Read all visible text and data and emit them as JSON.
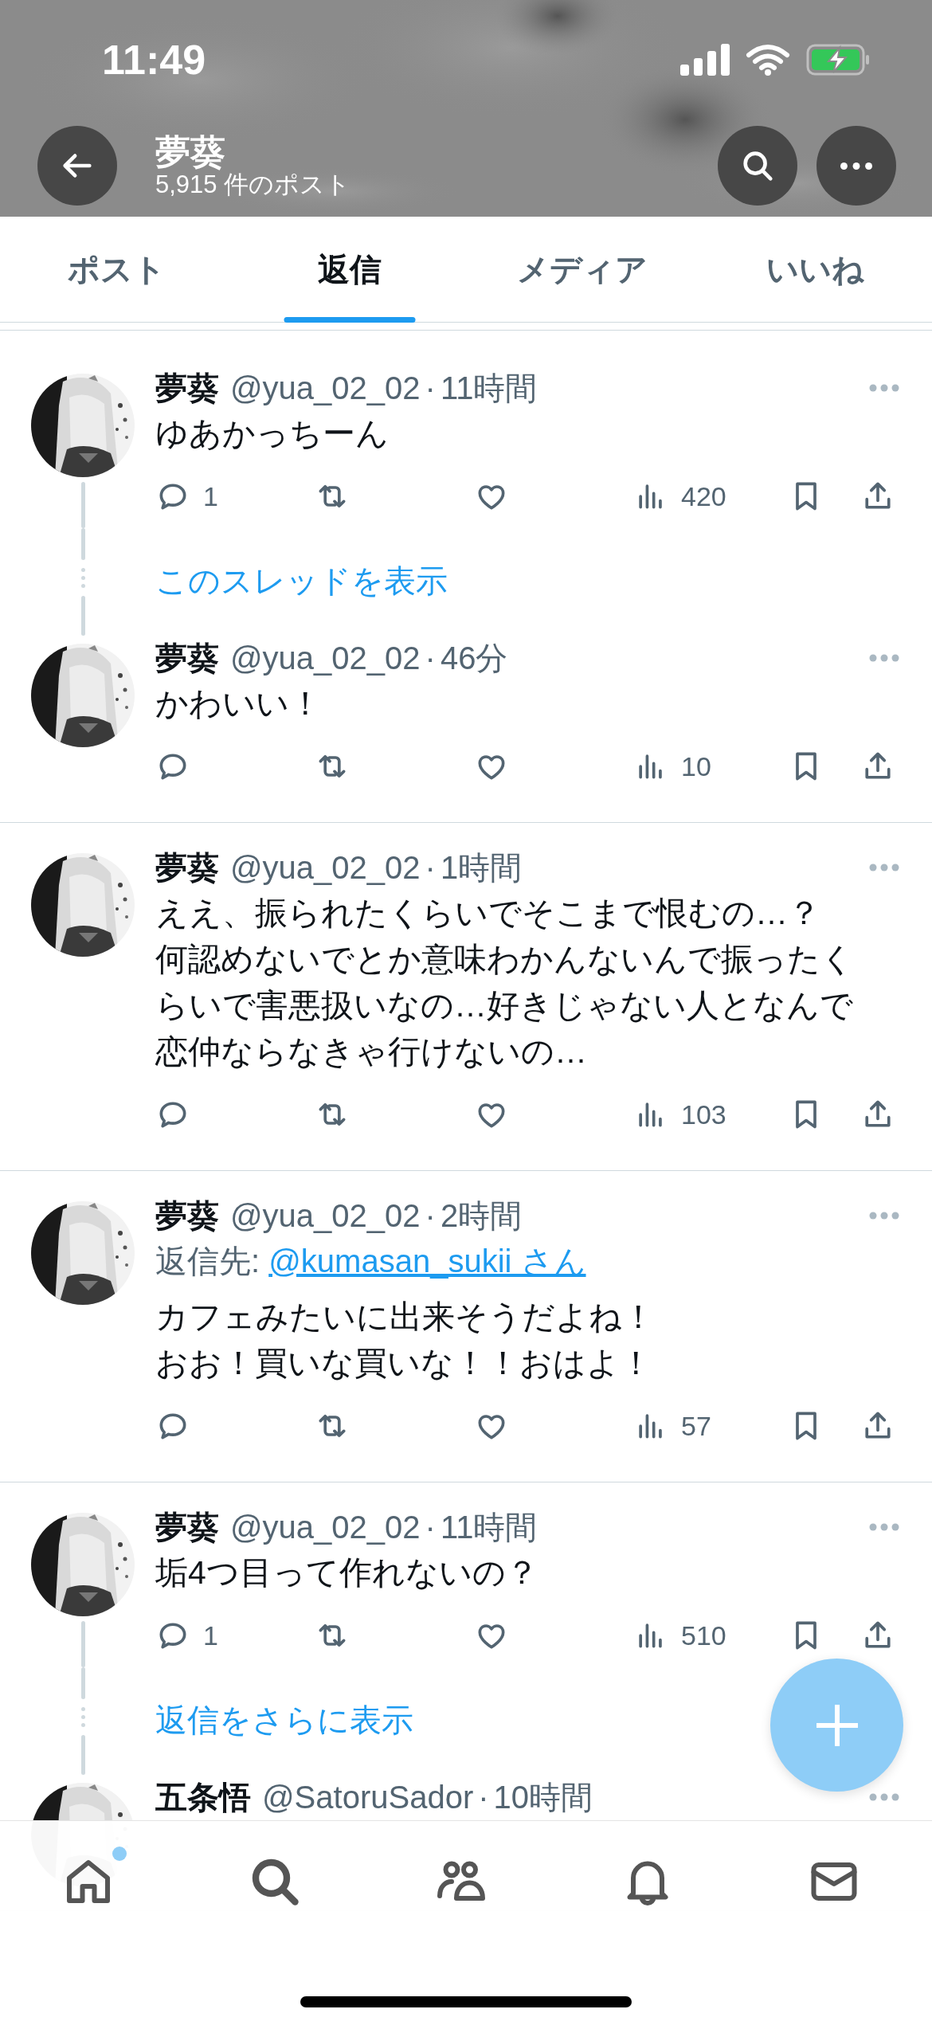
{
  "status_bar": {
    "time": "11:49"
  },
  "header": {
    "title": "夢葵",
    "subtitle": "5,915 件のポスト"
  },
  "tabs": [
    {
      "label": "ポスト",
      "selected": false
    },
    {
      "label": "返信",
      "selected": true
    },
    {
      "label": "メディア",
      "selected": false
    },
    {
      "label": "いいね",
      "selected": false
    }
  ],
  "threads": [
    {
      "items": [
        {
          "kind": "post",
          "name": "夢葵",
          "handle": "@yua_02_02",
          "separator": "·",
          "time": "11時間",
          "text": "ゆあかっちーん",
          "actions": {
            "replies": "1",
            "views": "420"
          }
        },
        {
          "kind": "link",
          "label": "このスレッドを表示"
        },
        {
          "kind": "post",
          "name": "夢葵",
          "handle": "@yua_02_02",
          "separator": "·",
          "time": "46分",
          "text": "かわいい！",
          "actions": {
            "views": "10"
          }
        }
      ]
    },
    {
      "items": [
        {
          "kind": "post",
          "name": "夢葵",
          "handle": "@yua_02_02",
          "separator": "·",
          "time": "1時間",
          "text": [
            "ええ、振られたくらいでそこまで恨むの…？",
            "何認めないでとか意味わかんないんで振ったくらいで害悪扱いなの…好きじゃない人となんで恋仲ならなきゃ行けないの…"
          ],
          "actions": {
            "views": "103"
          }
        }
      ]
    },
    {
      "items": [
        {
          "kind": "post",
          "name": "夢葵",
          "handle": "@yua_02_02",
          "separator": "·",
          "time": "2時間",
          "reply_to": {
            "label": "返信先:",
            "user": "@kumasan_sukii さん"
          },
          "text": [
            "カフェみたいに出来そうだよね！",
            "おお！買いな買いな！！おはよ！"
          ],
          "actions": {
            "views": "57"
          }
        }
      ]
    },
    {
      "items": [
        {
          "kind": "post",
          "name": "夢葵",
          "handle": "@yua_02_02",
          "separator": "·",
          "time": "11時間",
          "text": "垢4つ目って作れないの？",
          "actions": {
            "replies": "1",
            "views": "510"
          }
        },
        {
          "kind": "link",
          "label": "返信をさらに表示"
        },
        {
          "kind": "post",
          "name": "五条悟",
          "handle": "@SatoruSador",
          "separator": "·",
          "time": "10時間"
        }
      ]
    }
  ],
  "nav": [
    {
      "kind": "home",
      "badge": true
    },
    {
      "kind": "search",
      "badge": false
    },
    {
      "kind": "people",
      "badge": false
    },
    {
      "kind": "bell",
      "badge": false
    },
    {
      "kind": "mail",
      "badge": false
    }
  ]
}
